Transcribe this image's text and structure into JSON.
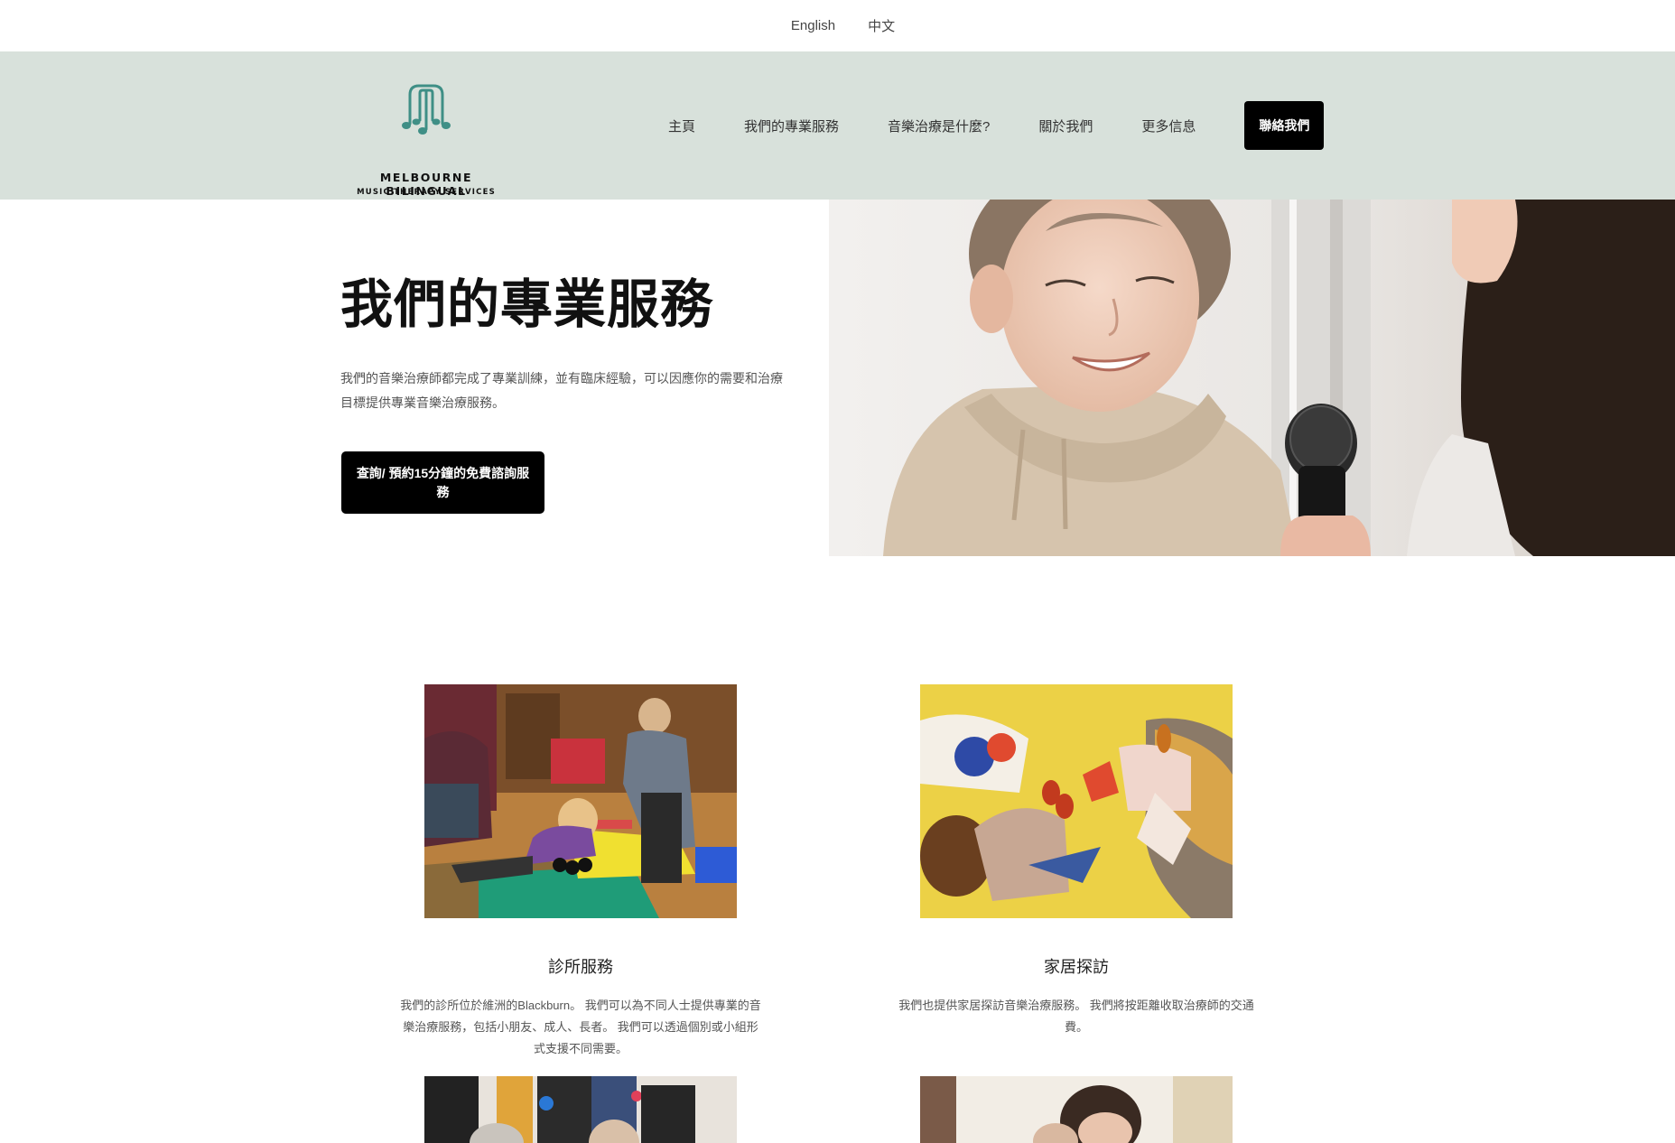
{
  "lang": {
    "english": "English",
    "chinese": "中文"
  },
  "logo": {
    "line1": "MELBOURNE BILINGUAL",
    "line2": "MUSIC THERAPY SERVICES",
    "accent": "#3f8f86"
  },
  "nav": {
    "home": "主頁",
    "services": "我們的專業服務",
    "what": "音樂治療是什麼?",
    "about": "關於我們",
    "more": "更多信息",
    "contact": "聯絡我們"
  },
  "hero": {
    "title": "我們的專業服務",
    "desc": "我們的音樂治療師都完成了專業訓練，並有臨床經驗，可以因應你的需要和治療目標提供專業音樂治療服務。",
    "button": "查詢/ 預約15分鐘的免費諮詢服務"
  },
  "services": [
    {
      "title": "診所服務",
      "desc": "我們的診所位於維洲的Blackburn。 我們可以為不同人士提供專業的音樂治療服務，包括小朋友、成人、長者。 我們可以透過個別或小組形式支援不同需要。"
    },
    {
      "title": "家居探訪",
      "desc": "我們也提供家居探訪音樂治療服務。 我們將按距離收取治療師的交通費。"
    }
  ],
  "colors": {
    "header_bg": "#d8e1db",
    "button_bg": "#000000"
  }
}
